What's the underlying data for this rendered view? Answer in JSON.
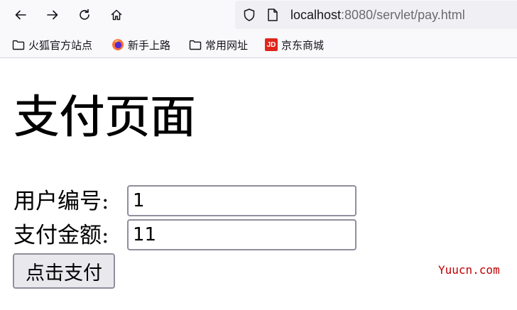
{
  "browser": {
    "url": {
      "host": "localhost",
      "rest": ":8080/servlet/pay.html"
    },
    "bookmarks": [
      {
        "label": "火狐官方站点",
        "icon": "folder-icon"
      },
      {
        "label": "新手上路",
        "icon": "firefox-icon"
      },
      {
        "label": "常用网址",
        "icon": "folder-icon"
      },
      {
        "label": "京东商城",
        "icon": "jd-icon",
        "badge": "JD"
      }
    ]
  },
  "page": {
    "title": "支付页面",
    "form": {
      "user_id_label": "用户编号:",
      "user_id_value": "1",
      "amount_label": "支付金额:",
      "amount_value": "11",
      "submit_label": "点击支付"
    },
    "watermark": "Yuucn.com"
  },
  "colors": {
    "watermark": "#c00000",
    "jd_brand": "#e1251b",
    "toolbar_bg": "#f9f9fb",
    "urlbar_bg": "#f0f0f4"
  }
}
